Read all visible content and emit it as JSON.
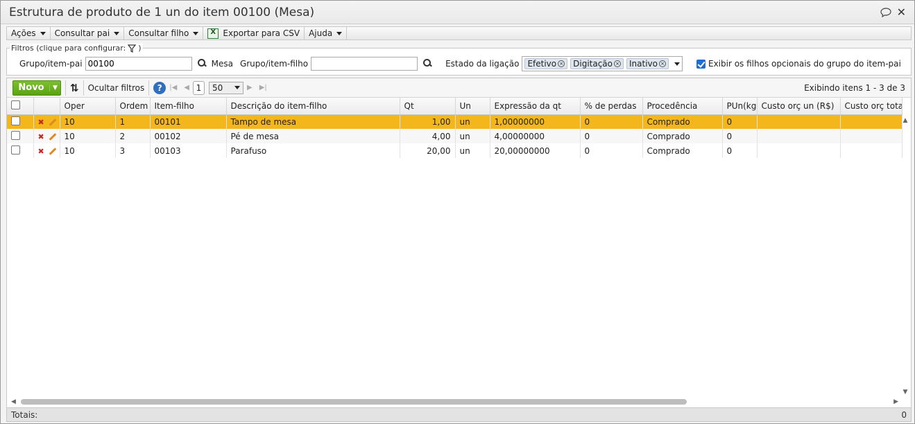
{
  "window": {
    "title": "Estrutura de produto de 1 un do item 00100 (Mesa)"
  },
  "menu": {
    "acoes": "Ações",
    "consultar_pai": "Consultar pai",
    "consultar_filho": "Consultar filho",
    "exportar_csv": "Exportar para CSV",
    "ajuda": "Ajuda"
  },
  "filters": {
    "legend": "Filtros (clique para configurar:",
    "legend_close": ")",
    "grupo_pai_label": "Grupo/item-pai",
    "grupo_pai_value": "00100",
    "grupo_pai_desc": "Mesa",
    "grupo_filho_label": "Grupo/item-filho",
    "grupo_filho_value": "",
    "estado_label": "Estado da ligação",
    "estado_tags": [
      "Efetivo",
      "Digitação",
      "Inativo"
    ],
    "exibir_label": "Exibir os filhos opcionais do grupo do item-pai",
    "exibir_checked": true
  },
  "toolbar": {
    "novo": "Novo",
    "ocultar_filtros": "Ocultar filtros",
    "page": "1",
    "page_size": "50",
    "showing": "Exibindo itens 1 - 3 de 3"
  },
  "table": {
    "columns": [
      "Oper",
      "Ordem",
      "Item-filho",
      "Descrição do item-filho",
      "Qt",
      "Un",
      "Expressão da qt",
      "% de perdas",
      "Procedência",
      "PUn(kg)",
      "Custo orç un (R$)",
      "Custo orç total"
    ],
    "rows": [
      {
        "oper": "10",
        "ordem": "1",
        "item": "00101",
        "desc": "Tampo de mesa",
        "qt": "1,00",
        "un": "un",
        "expr": "1,00000000",
        "perdas": "0",
        "proc": "Comprado",
        "pun": "0",
        "custo_un": "",
        "custo_total": ""
      },
      {
        "oper": "10",
        "ordem": "2",
        "item": "00102",
        "desc": "Pé de mesa",
        "qt": "4,00",
        "un": "un",
        "expr": "4,00000000",
        "perdas": "0",
        "proc": "Comprado",
        "pun": "0",
        "custo_un": "",
        "custo_total": ""
      },
      {
        "oper": "10",
        "ordem": "3",
        "item": "00103",
        "desc": "Parafuso",
        "qt": "20,00",
        "un": "un",
        "expr": "20,00000000",
        "perdas": "0",
        "proc": "Comprado",
        "pun": "0",
        "custo_un": "",
        "custo_total": ""
      }
    ],
    "selected_row": 0
  },
  "totals": {
    "label": "Totais:",
    "value": "0"
  },
  "colors": {
    "selected_row": "#f4b71b",
    "novo_button": "#5ba312"
  }
}
